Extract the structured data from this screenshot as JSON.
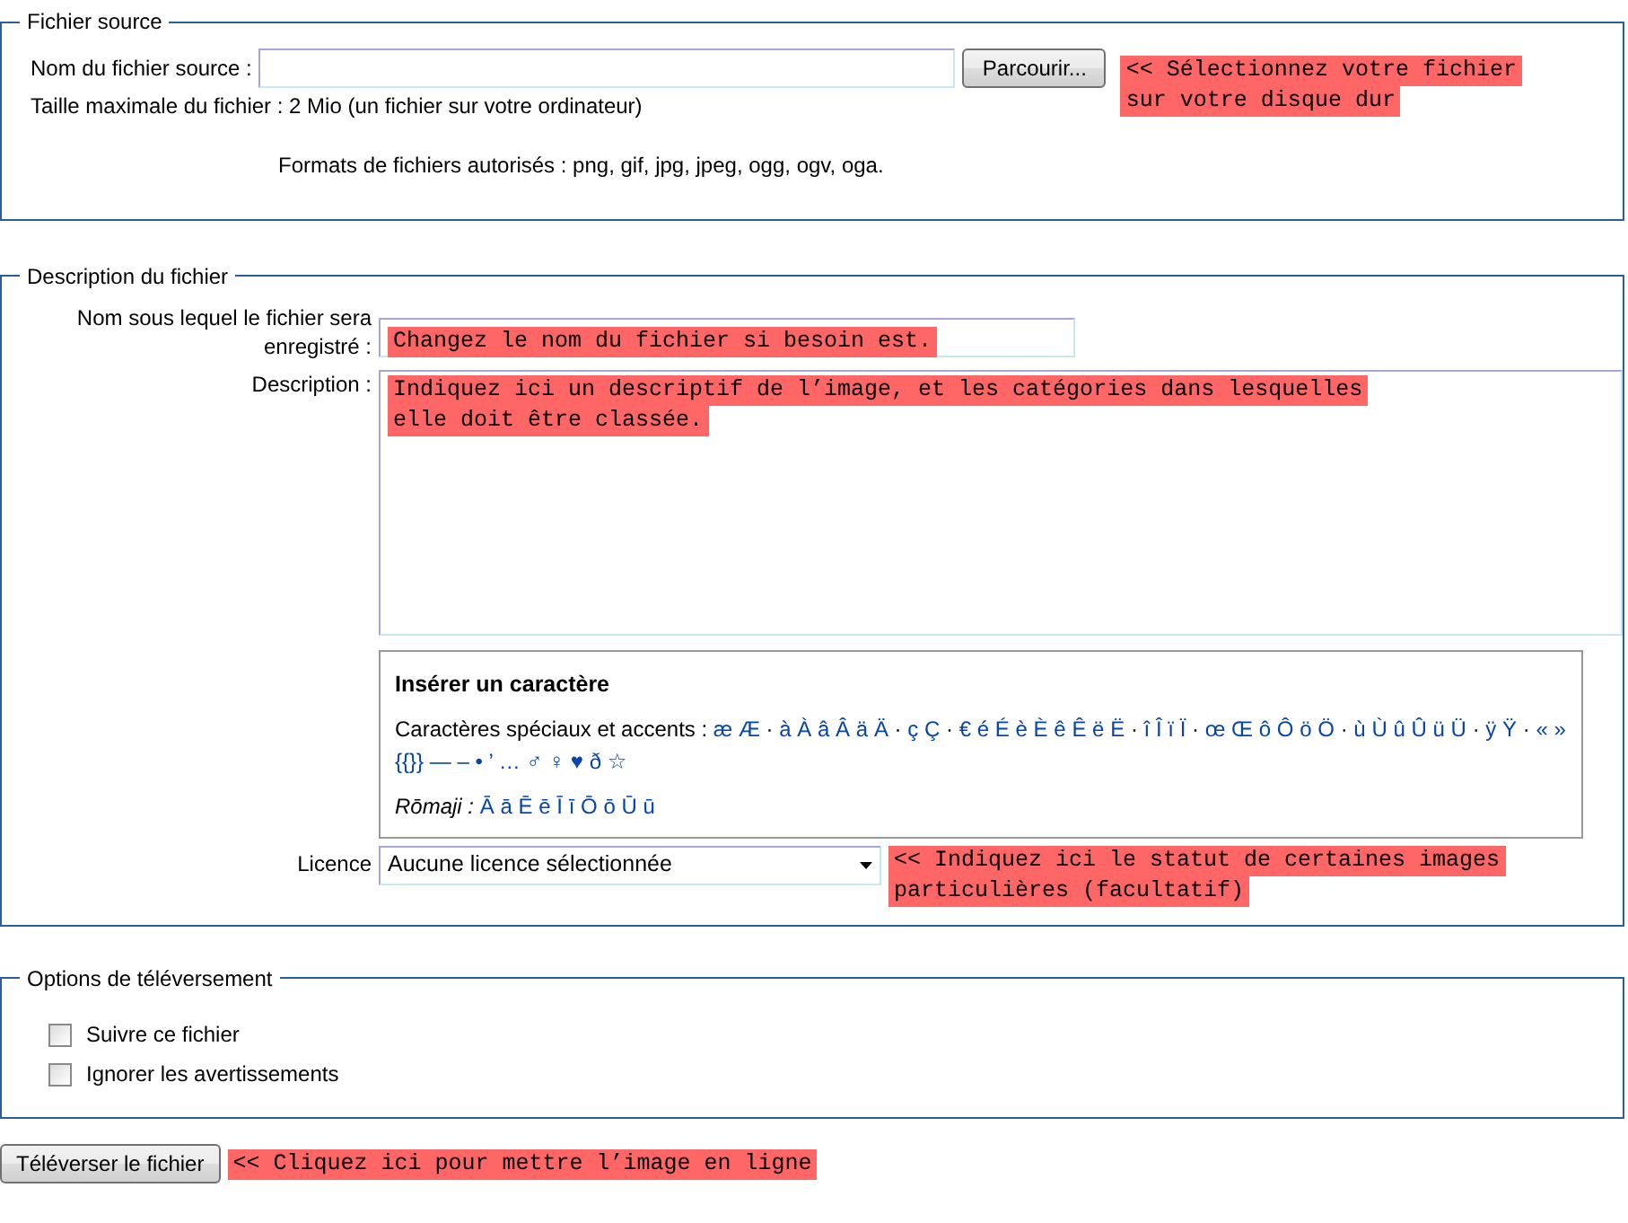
{
  "source": {
    "legend": "Fichier source",
    "file_label": "Nom du fichier source :",
    "browse_button": "Parcourir...",
    "browse_note": [
      "<< Sélectionnez votre fichier",
      "sur votre disque dur"
    ],
    "max_size": "Taille maximale du fichier : 2 Mio (un fichier sur votre ordinateur)",
    "formats": "Formats de fichiers autorisés : png, gif, jpg, jpeg, ogg, ogv, oga."
  },
  "description": {
    "legend": "Description du fichier",
    "name_label": "Nom sous lequel le fichier sera enregistré :",
    "name_note": "Changez le nom du fichier si besoin est.",
    "desc_label": "Description :",
    "desc_note": [
      "Indiquez ici un descriptif de l’image, et les catégories dans lesquelles",
      "elle doit être classée."
    ],
    "charinsert": {
      "title": "Insérer un caractère",
      "special_label": "Caractères spéciaux et accents :",
      "special": [
        {
          "kind": "char",
          "text": "æ"
        },
        {
          "kind": "char",
          "text": "Æ"
        },
        {
          "kind": "sep",
          "text": "·"
        },
        {
          "kind": "char",
          "text": "à"
        },
        {
          "kind": "char",
          "text": "À"
        },
        {
          "kind": "char",
          "text": "â"
        },
        {
          "kind": "char",
          "text": "Â"
        },
        {
          "kind": "char",
          "text": "ä"
        },
        {
          "kind": "char",
          "text": "Ä"
        },
        {
          "kind": "sep",
          "text": "·"
        },
        {
          "kind": "char",
          "text": "ç"
        },
        {
          "kind": "char",
          "text": "Ç"
        },
        {
          "kind": "sep",
          "text": "·"
        },
        {
          "kind": "char",
          "text": "€"
        },
        {
          "kind": "char",
          "text": "é"
        },
        {
          "kind": "char",
          "text": "É"
        },
        {
          "kind": "char",
          "text": "è"
        },
        {
          "kind": "char",
          "text": "È"
        },
        {
          "kind": "char",
          "text": "ê"
        },
        {
          "kind": "char",
          "text": "Ê"
        },
        {
          "kind": "char",
          "text": "ë"
        },
        {
          "kind": "char",
          "text": "Ë"
        },
        {
          "kind": "sep",
          "text": "·"
        },
        {
          "kind": "char",
          "text": "î"
        },
        {
          "kind": "char",
          "text": "Î"
        },
        {
          "kind": "char",
          "text": "ï"
        },
        {
          "kind": "char",
          "text": "Ï"
        },
        {
          "kind": "sep",
          "text": "·"
        },
        {
          "kind": "char",
          "text": "œ"
        },
        {
          "kind": "char",
          "text": "Œ"
        },
        {
          "kind": "char",
          "text": "ô"
        },
        {
          "kind": "char",
          "text": "Ô"
        },
        {
          "kind": "char",
          "text": "ö"
        },
        {
          "kind": "char",
          "text": "Ö"
        },
        {
          "kind": "sep",
          "text": "·"
        },
        {
          "kind": "char",
          "text": "ù"
        },
        {
          "kind": "char",
          "text": "Ù"
        },
        {
          "kind": "char",
          "text": "û"
        },
        {
          "kind": "char",
          "text": "Û"
        },
        {
          "kind": "char",
          "text": "ü"
        },
        {
          "kind": "char",
          "text": "Ü"
        },
        {
          "kind": "sep",
          "text": "·"
        },
        {
          "kind": "char",
          "text": "ÿ"
        },
        {
          "kind": "char",
          "text": "Ÿ"
        },
        {
          "kind": "sep",
          "text": "·"
        },
        {
          "kind": "char",
          "text": "«"
        },
        {
          "kind": "char",
          "text": "»"
        },
        {
          "kind": "char",
          "text": "{{}}"
        },
        {
          "kind": "char",
          "text": "—"
        },
        {
          "kind": "char",
          "text": "–"
        },
        {
          "kind": "char",
          "text": "•"
        },
        {
          "kind": "char",
          "text": "’"
        },
        {
          "kind": "char",
          "text": "…"
        },
        {
          "kind": "char",
          "text": "♂"
        },
        {
          "kind": "char",
          "text": "♀"
        },
        {
          "kind": "char",
          "text": "♥"
        },
        {
          "kind": "char",
          "text": "ð"
        },
        {
          "kind": "char",
          "text": "☆"
        }
      ],
      "romaji_label": "Rōmaji :",
      "romaji": [
        "Ā",
        "ā",
        "Ē",
        "ē",
        "Ī",
        "ī",
        "Ō",
        "ō",
        "Ū",
        "ū"
      ]
    },
    "license_label": "Licence",
    "license_value": "Aucune licence sélectionnée",
    "license_note": [
      "<< Indiquez ici le statut de certaines images",
      "particulières (facultatif)"
    ]
  },
  "options": {
    "legend": "Options de téléversement",
    "checkboxes": [
      {
        "label": "Suivre ce fichier",
        "checked": false
      },
      {
        "label": "Ignorer les avertissements",
        "checked": false
      }
    ]
  },
  "submit": {
    "label": "Téléverser le fichier",
    "note": "<< Cliquez ici pour mettre l’image en ligne"
  }
}
